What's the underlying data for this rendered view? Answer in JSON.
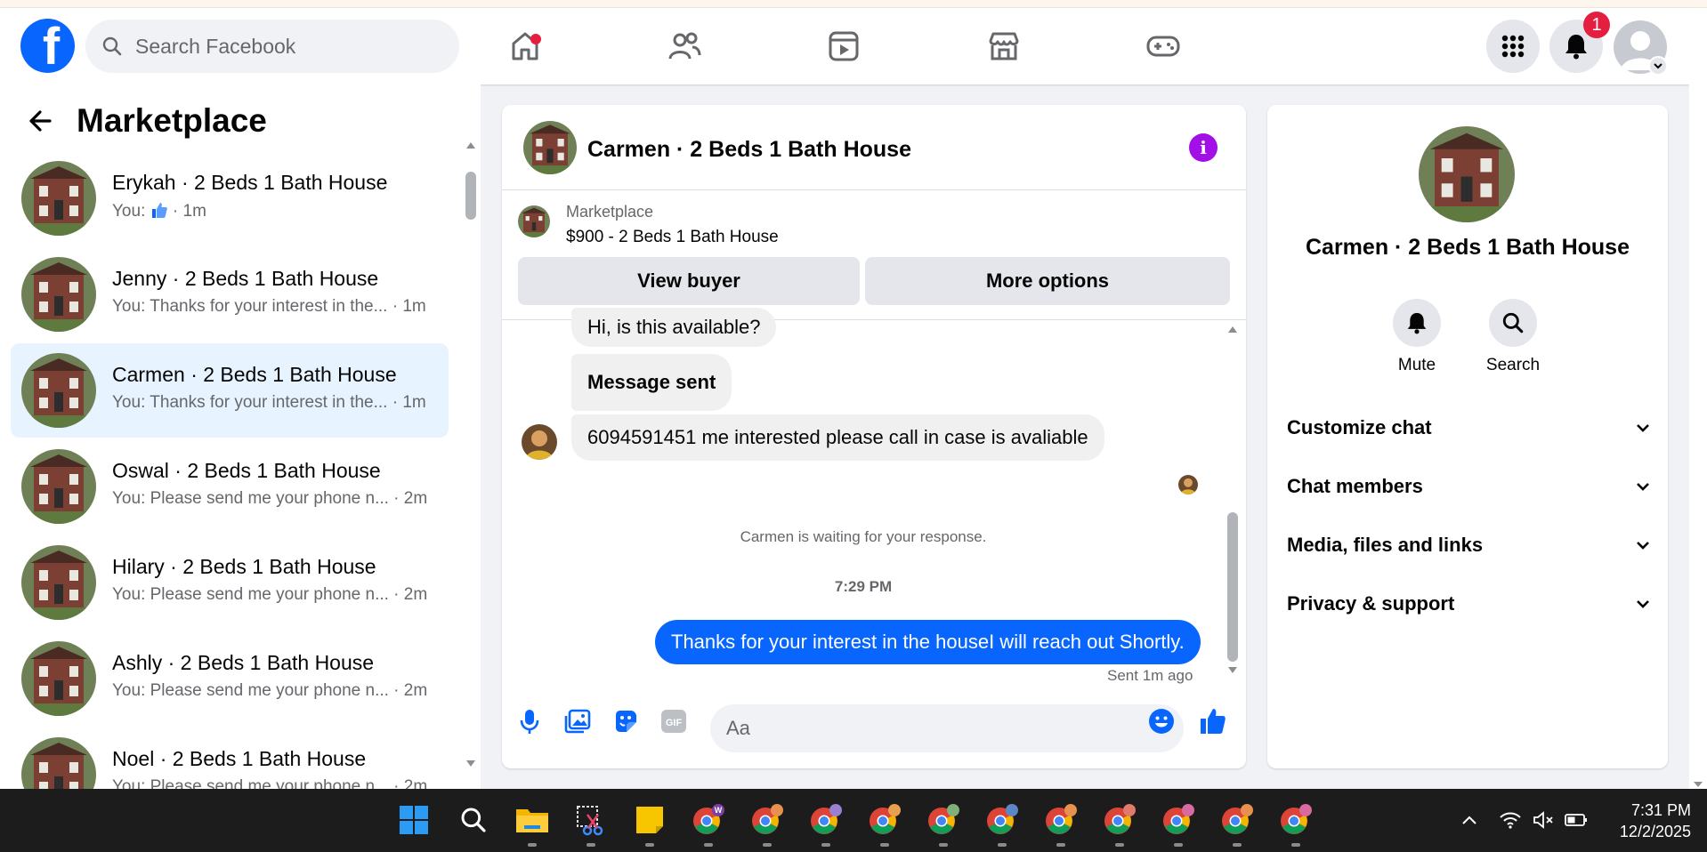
{
  "header": {
    "logo": "facebook-logo",
    "logo_letter": "f",
    "search_placeholder": "Search Facebook",
    "notification_count": "1"
  },
  "left_panel": {
    "title": "Marketplace",
    "conversations": [
      {
        "name": "Erykah · 2 Beds 1 Bath House",
        "preview_prefix": "You:",
        "preview_suffix": "· 1m",
        "preview_icon": "thumbs-up-icon"
      },
      {
        "name": "Jenny · 2 Beds 1 Bath House",
        "preview": "You: Thanks for your interest in the... · 1m"
      },
      {
        "name": "Carmen · 2 Beds 1 Bath House",
        "preview": "You: Thanks for your interest in the... · 1m",
        "active": true
      },
      {
        "name": "Oswal · 2 Beds 1 Bath House",
        "preview": "You: Please send me your phone n... · 2m"
      },
      {
        "name": "Hilary · 2 Beds 1 Bath House",
        "preview": "You: Please send me your phone n... · 2m"
      },
      {
        "name": "Ashly · 2 Beds 1 Bath House",
        "preview": "You: Please send me your phone n... · 2m"
      },
      {
        "name": "Noel · 2 Beds 1 Bath House",
        "preview": "You: Please send me your phone n... · 2m"
      }
    ]
  },
  "chat": {
    "title": "Carmen · 2 Beds 1 Bath House",
    "marketplace_label": "Marketplace",
    "listing": "$900 - 2 Beds 1 Bath House",
    "view_buyer": "View buyer",
    "more_options": "More options",
    "messages": {
      "m1": "Hi, is this available?",
      "m2": "Message sent",
      "m3": "6094591451 me interested please call in case is avaliable"
    },
    "waiting_text": "Carmen is waiting for your response.",
    "time": "7:29 PM",
    "outgoing": "Thanks for your interest in the houseI will reach out Shortly.",
    "sent_status": "Sent 1m ago",
    "composer_placeholder": "Aa"
  },
  "right_panel": {
    "name": "Carmen · 2 Beds 1 Bath House",
    "mute": "Mute",
    "search": "Search",
    "sections": [
      "Customize chat",
      "Chat members",
      "Media, files and links",
      "Privacy & support"
    ]
  },
  "taskbar": {
    "time": "7:31 PM",
    "date": "12/2/2025"
  },
  "colors": {
    "brand": "#0866ff",
    "active_bg": "#e7f3ff",
    "info": "#a30fe7",
    "badge": "#e41e3f"
  }
}
